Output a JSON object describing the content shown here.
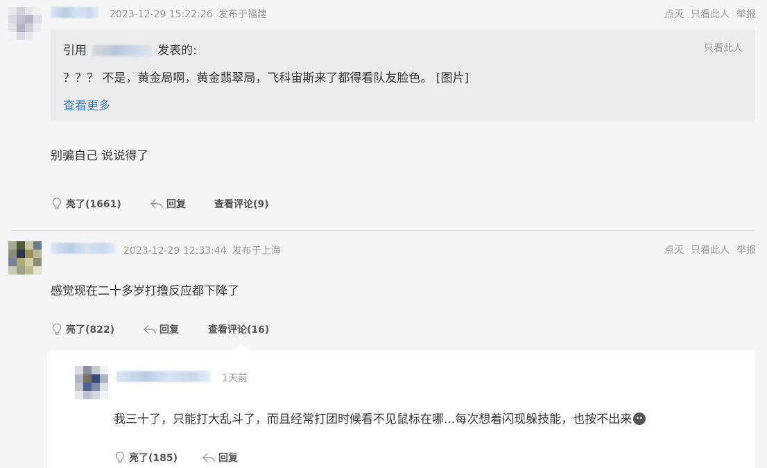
{
  "post1": {
    "timestamp": "2023-12-29 15:22:26",
    "location": "发布于福建",
    "ops": [
      "点灭",
      "只看此人",
      "举报"
    ],
    "quote": {
      "prefix": "引用",
      "suffix": "发表的:",
      "only_this": "只看此人",
      "text": "？？？ 不是，黄金局啊，黄金翡翠局，飞科宙斯来了都得看队友脸色。 [图片]",
      "more": "查看更多"
    },
    "content": "别骗自己 说说得了",
    "actions": {
      "like": "亮了(1661)",
      "reply": "回复",
      "comments": "查看评论(9)"
    }
  },
  "post2": {
    "timestamp": "2023-12-29 12:33:44",
    "location": "发布于上海",
    "ops": [
      "点灭",
      "只看此人",
      "举报"
    ],
    "content": "感觉现在二十多岁打撸反应都下降了",
    "actions": {
      "like": "亮了(822)",
      "reply": "回复",
      "comments": "查看评论(16)"
    }
  },
  "subreply": {
    "time": "1天前",
    "content": "我三十了，只能打大乱斗了，而且经常打团时候看不见鼠标在哪...每次想着闪现躲技能，也按不出来",
    "actions": {
      "like": "亮了(185)",
      "reply": "回复"
    }
  },
  "icons": {
    "like": "lightbulb-icon",
    "reply": "reply-arrow-icon",
    "emoji": "sad-face-icon"
  }
}
